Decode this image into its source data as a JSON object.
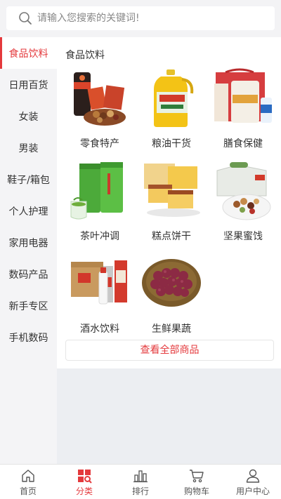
{
  "search": {
    "placeholder": "请输入您搜索的关键词!"
  },
  "sidebar": {
    "items": [
      {
        "label": "食品饮料",
        "active": true
      },
      {
        "label": "日用百货"
      },
      {
        "label": "女装"
      },
      {
        "label": "男装"
      },
      {
        "label": "鞋子/箱包"
      },
      {
        "label": "个人护理"
      },
      {
        "label": "家用电器"
      },
      {
        "label": "数码产品"
      },
      {
        "label": "新手专区"
      },
      {
        "label": "手机数码"
      }
    ]
  },
  "content": {
    "title": "食品饮料",
    "products": [
      {
        "name": "零食特产",
        "icon": "snacks-image"
      },
      {
        "name": "粮油干货",
        "icon": "cooking-oil-image"
      },
      {
        "name": "膳食保健",
        "icon": "health-supplement-image"
      },
      {
        "name": "茶叶冲调",
        "icon": "tea-cans-image"
      },
      {
        "name": "糕点饼干",
        "icon": "cake-pastry-image"
      },
      {
        "name": "坚果蜜饯",
        "icon": "nuts-image"
      },
      {
        "name": "酒水饮料",
        "icon": "liquor-box-image"
      },
      {
        "name": "生鲜果蔬",
        "icon": "grapes-basket-image"
      }
    ],
    "view_all": "查看全部商品"
  },
  "tabbar": {
    "items": [
      {
        "label": "首页",
        "icon": "home-icon"
      },
      {
        "label": "分类",
        "icon": "category-icon",
        "active": true
      },
      {
        "label": "排行",
        "icon": "ranking-icon"
      },
      {
        "label": "购物车",
        "icon": "cart-icon"
      },
      {
        "label": "用户中心",
        "icon": "user-icon"
      }
    ]
  },
  "colors": {
    "accent": "#e4393c"
  }
}
